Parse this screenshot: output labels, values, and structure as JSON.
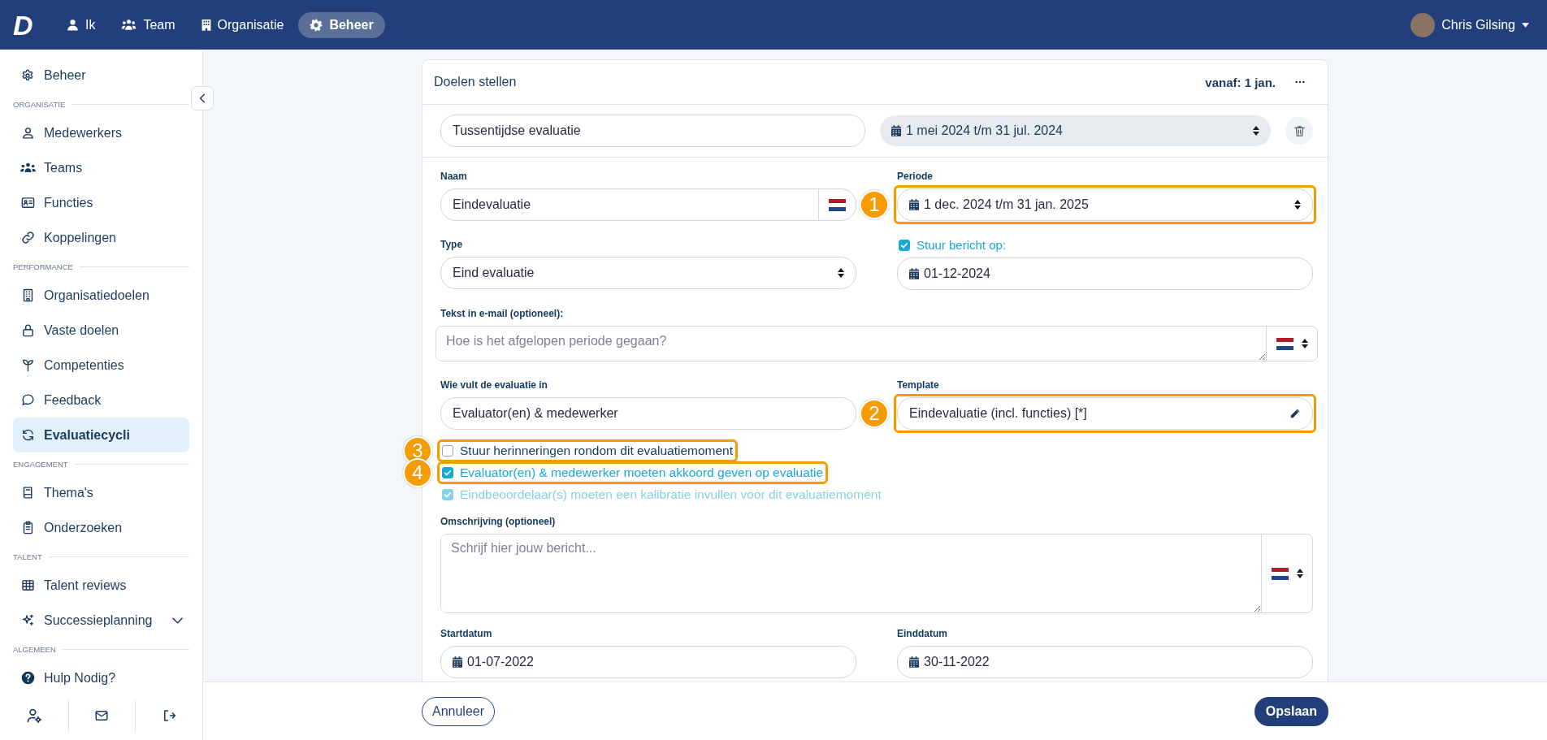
{
  "topbar": {
    "logo": "D",
    "nav": [
      {
        "label": "Ik",
        "selected": false
      },
      {
        "label": "Team",
        "selected": false
      },
      {
        "label": "Organisatie",
        "selected": false
      },
      {
        "label": "Beheer",
        "selected": true
      }
    ],
    "user": {
      "name": "Chris Gilsing"
    }
  },
  "sidebar": {
    "items": [
      {
        "kind": "item",
        "label": "Beheer",
        "selected": false
      },
      {
        "kind": "heading",
        "label": "ORGANISATIE"
      },
      {
        "kind": "item",
        "label": "Medewerkers",
        "selected": false
      },
      {
        "kind": "item",
        "label": "Teams",
        "selected": false
      },
      {
        "kind": "item",
        "label": "Functies",
        "selected": false
      },
      {
        "kind": "item",
        "label": "Koppelingen",
        "selected": false
      },
      {
        "kind": "heading",
        "label": "PERFORMANCE"
      },
      {
        "kind": "item",
        "label": "Organisatiedoelen",
        "selected": false
      },
      {
        "kind": "item",
        "label": "Vaste doelen",
        "selected": false
      },
      {
        "kind": "item",
        "label": "Competenties",
        "selected": false
      },
      {
        "kind": "item",
        "label": "Feedback",
        "selected": false
      },
      {
        "kind": "item",
        "label": "Evaluatiecycli",
        "selected": true
      },
      {
        "kind": "heading",
        "label": "ENGAGEMENT"
      },
      {
        "kind": "item",
        "label": "Thema's",
        "selected": false
      },
      {
        "kind": "item",
        "label": "Onderzoeken",
        "selected": false
      },
      {
        "kind": "heading",
        "label": "TALENT"
      },
      {
        "kind": "item",
        "label": "Talent reviews",
        "selected": false
      },
      {
        "kind": "item",
        "label": "Successieplanning",
        "selected": false,
        "expanded": false
      },
      {
        "kind": "heading",
        "label": "ALGEMEEN"
      },
      {
        "kind": "item",
        "label": "Hulp Nodig?",
        "selected": false
      }
    ]
  },
  "card": {
    "title": "Doelen stellen",
    "from": "vanaf: 1 jan.",
    "moment": {
      "name": "Tussentijdse evaluatie",
      "period": "1 mei 2024 t/m 31 jul. 2024"
    },
    "form": {
      "name": {
        "label": "Naam",
        "value": "Eindevaluatie"
      },
      "period": {
        "label": "Periode",
        "value": "1 dec. 2024 t/m 31 jan. 2025",
        "callout": "1"
      },
      "type": {
        "label": "Type",
        "value": "Eind evaluatie"
      },
      "send_message": {
        "label": "Stuur bericht op:",
        "checked": true,
        "date": "01-12-2024"
      },
      "email_text": {
        "label": "Tekst in e-mail (optioneel):",
        "placeholder": "Hoe is het afgelopen periode gegaan?"
      },
      "filled_by": {
        "label": "Wie vult de evaluatie in",
        "value": "Evaluator(en) & medewerker"
      },
      "template": {
        "label": "Template",
        "value": "Eindevaluatie (incl. functies) [*]",
        "callout": "2"
      },
      "options": [
        {
          "label": "Stuur herinneringen rondom dit evaluatiemoment",
          "checked": false,
          "disabled": false,
          "callout": "3"
        },
        {
          "label": "Evaluator(en) & medewerker moeten akkoord geven op evaluatie",
          "checked": true,
          "disabled": false,
          "callout": "4"
        },
        {
          "label": "Eindbeoordelaar(s) moeten een kalibratie invullen voor dit evaluatiemoment",
          "checked": true,
          "disabled": true
        }
      ],
      "description": {
        "label": "Omschrijving (optioneel)",
        "placeholder": "Schrijf hier jouw bericht..."
      },
      "start": {
        "label": "Startdatum",
        "value": "01-07-2022"
      },
      "end": {
        "label": "Einddatum",
        "value": "30-11-2022"
      }
    }
  },
  "footer": {
    "cancel": "Annuleer",
    "save": "Opslaan"
  }
}
